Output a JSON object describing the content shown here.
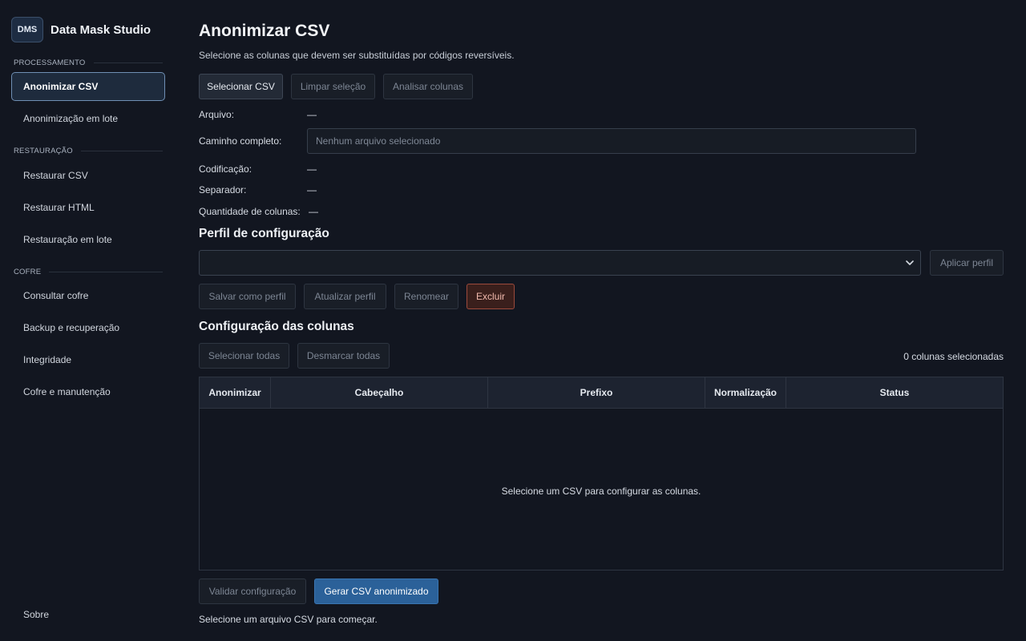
{
  "sidebar": {
    "logo": "DMS",
    "app_name": "Data Mask Studio",
    "sections": {
      "processing": "PROCESSAMENTO",
      "restoration": "RESTAURAÇÃO",
      "vault": "COFRE"
    },
    "items": {
      "anonymize_csv": "Anonimizar CSV",
      "batch_anonymize": "Anonimização em lote",
      "restore_csv": "Restaurar CSV",
      "restore_html": "Restaurar HTML",
      "batch_restore": "Restauração em lote",
      "query_vault": "Consultar cofre",
      "backup": "Backup e recuperação",
      "integrity": "Integridade",
      "vault_maintenance": "Cofre e manutenção",
      "about": "Sobre"
    }
  },
  "main": {
    "title": "Anonimizar CSV",
    "subtitle": "Selecione as colunas que devem ser substituídas por códigos reversíveis.",
    "file_actions": {
      "select_csv": "Selecionar CSV",
      "clear_selection": "Limpar seleção",
      "analyze_columns": "Analisar colunas"
    },
    "file_info": {
      "file_label": "Arquivo:",
      "file_value": "—",
      "path_label": "Caminho completo:",
      "path_placeholder": "Nenhum arquivo selecionado",
      "encoding_label": "Codificação:",
      "encoding_value": "—",
      "separator_label": "Separador:",
      "separator_value": "—",
      "columns_label": "Quantidade de colunas:",
      "columns_value": "—"
    },
    "profile": {
      "title": "Perfil de configuração",
      "selected": "",
      "apply": "Aplicar perfil",
      "save_as": "Salvar como perfil",
      "update": "Atualizar perfil",
      "rename": "Renomear",
      "delete": "Excluir"
    },
    "columns": {
      "title": "Configuração das colunas",
      "select_all": "Selecionar todas",
      "deselect_all": "Desmarcar todas",
      "count": "0 colunas selecionadas",
      "headers": [
        "Anonimizar",
        "Cabeçalho",
        "Prefixo",
        "Normalização",
        "Status"
      ],
      "empty": "Selecione um CSV para configurar as colunas."
    },
    "footer": {
      "validate": "Validar configuração",
      "generate": "Gerar CSV anonimizado",
      "status": "Selecione um arquivo CSV para começar."
    }
  },
  "colors": {
    "background": "#121620",
    "accent": "#2b6199",
    "danger": "#9c4a3c"
  }
}
